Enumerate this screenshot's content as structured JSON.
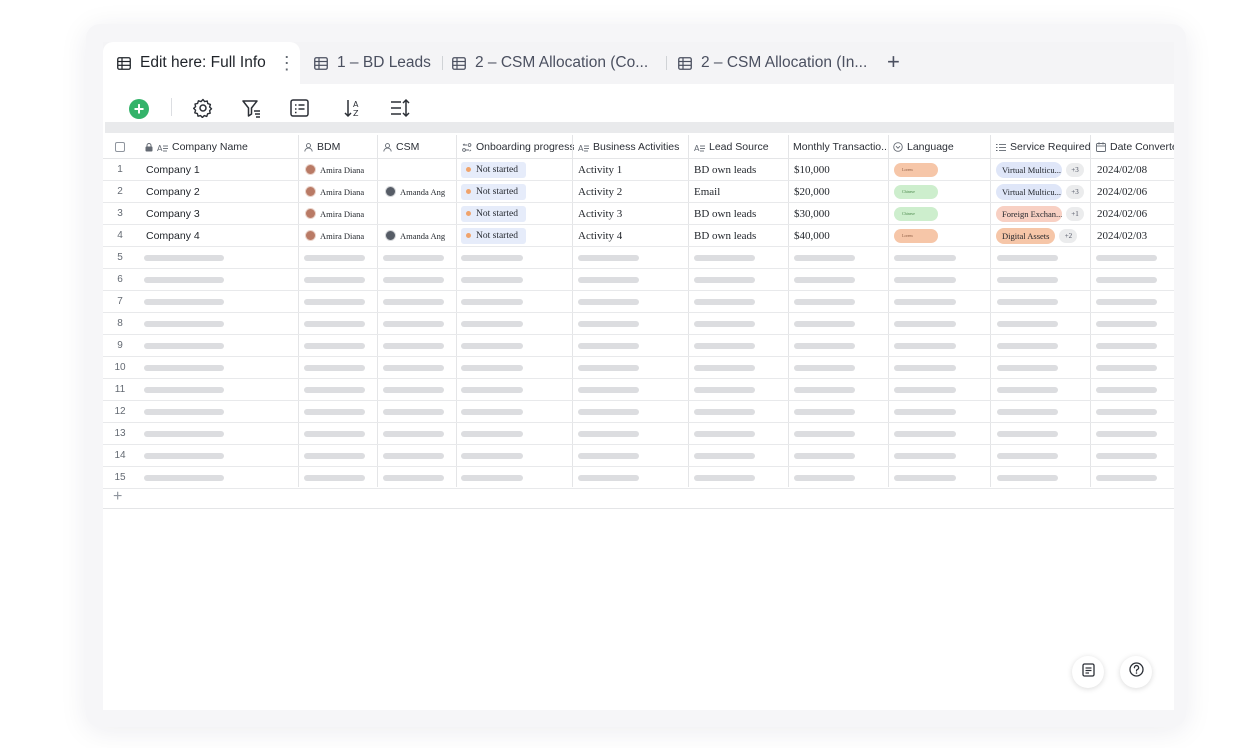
{
  "tabs": [
    {
      "label": "Edit here: Full Info",
      "active": true
    },
    {
      "label": "1 – BD Leads"
    },
    {
      "label": "2 – CSM Allocation (Co..."
    },
    {
      "label": "2 – CSM Allocation (In..."
    }
  ],
  "tab_more": "⋮",
  "add_tab": "+",
  "toolbar": {
    "add_icon": "plus-circle-icon",
    "settings_icon": "gear-icon",
    "filter_icon": "filter-icon",
    "fields_icon": "list-icon",
    "sort_icon": "sort-az-icon",
    "rowheight_icon": "row-height-icon"
  },
  "columns": [
    {
      "label": "Company Name",
      "icon": "text-field-icon"
    },
    {
      "label": "BDM",
      "icon": "person-icon"
    },
    {
      "label": "CSM",
      "icon": "person-icon"
    },
    {
      "label": "Onboarding progress",
      "icon": "progress-icon"
    },
    {
      "label": "Business Activities",
      "icon": "text-field-icon"
    },
    {
      "label": "Lead Source",
      "icon": "text-field-icon"
    },
    {
      "label": "Monthly Transactio...",
      "icon": ""
    },
    {
      "label": "Language",
      "icon": "single-select-icon"
    },
    {
      "label": "Service Required",
      "icon": "multi-select-icon"
    },
    {
      "label": "Date Converte",
      "icon": "calendar-icon"
    }
  ],
  "rows": [
    {
      "num": "1",
      "company": "Company 1",
      "bdm": "Amira Diana",
      "csm": "",
      "progress": "Not started",
      "activity": "Activity 1",
      "lead": "BD own leads",
      "monthly": "$10,000",
      "lang": "Lorem",
      "service": "Virtual Multicu...",
      "service_more": "+3",
      "date": "2024/02/08"
    },
    {
      "num": "2",
      "company": "Company 2",
      "bdm": "Amira Diana",
      "csm": "Amanda Ang",
      "progress": "Not started",
      "activity": "Activity 2",
      "lead": "Email",
      "monthly": "$20,000",
      "lang": "Chinese",
      "service": "Virtual Multicu...",
      "service_more": "+3",
      "date": "2024/02/06"
    },
    {
      "num": "3",
      "company": "Company 3",
      "bdm": "Amira Diana",
      "csm": "",
      "progress": "Not started",
      "activity": "Activity 3",
      "lead": "BD own leads",
      "monthly": "$30,000",
      "lang": "Chinese",
      "service": "Foreign Exchan...",
      "service_more": "+1",
      "date": "2024/02/06"
    },
    {
      "num": "4",
      "company": "Company 4",
      "bdm": "Amira Diana",
      "csm": "Amanda Ang",
      "progress": "Not started",
      "activity": "Activity 4",
      "lead": "BD own leads",
      "monthly": "$40,000",
      "lang": "Lorem",
      "service": "Digital Assets",
      "service_more": "+2",
      "date": "2024/02/03"
    }
  ],
  "placeholder_rows": [
    "5",
    "6",
    "7",
    "8",
    "9",
    "10",
    "11",
    "12",
    "13",
    "14",
    "15"
  ],
  "add_row": "+",
  "colors": {
    "accent_green": "#34b36a",
    "status_chip": "#e6ecfa",
    "tag_orange": "#f6c6a8",
    "tag_green": "#cdeecd",
    "tag_blue": "#dfe6f8",
    "tag_pink": "#f8d0c3"
  },
  "bottom_buttons": {
    "notes_icon": "document-icon",
    "help_icon": "help-circle-icon"
  }
}
